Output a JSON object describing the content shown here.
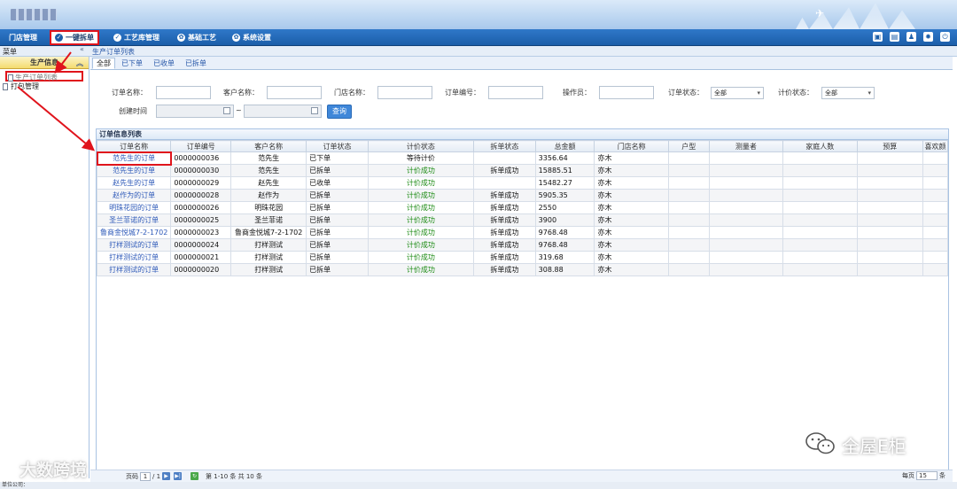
{
  "nav": {
    "items": [
      {
        "label": "门店管理",
        "icon": "none"
      },
      {
        "label": "一键拆单",
        "icon": "check-circle-icon"
      },
      {
        "label": "工艺库管理",
        "icon": "check-circle-icon"
      },
      {
        "label": "基础工艺",
        "icon": "gear-icon"
      },
      {
        "label": "系统设置",
        "icon": "gear-icon"
      }
    ],
    "tool_icons": [
      "monitor-icon",
      "document-icon",
      "users-icon",
      "gear-icon",
      "exit-icon"
    ]
  },
  "breadcrumb": {
    "menu": "菜单",
    "collapse": "«",
    "current": "生产订单列表"
  },
  "sidebar": {
    "group": "生产信息",
    "items": [
      {
        "label": "生产订单列表"
      },
      {
        "label": "打包管理"
      }
    ]
  },
  "tabs": [
    "全部",
    "已下单",
    "已收单",
    "已拆单"
  ],
  "filter": {
    "order_name_label": "订单名称：",
    "customer_name_label": "客户名称：",
    "store_name_label": "门店名称：",
    "order_no_label": "订单编号：",
    "operator_label": "操作员：",
    "order_status_label": "订单状态：",
    "order_status_value": "全部",
    "price_status_label": "计价状态：",
    "price_status_value": "全部",
    "created_label": "创建时间",
    "range_sep": "~",
    "query_button": "查询"
  },
  "table": {
    "title": "订单信息列表",
    "columns": [
      "订单名称",
      "订单编号",
      "客户名称",
      "订单状态",
      "计价状态",
      "拆单状态",
      "总金额",
      "门店名称",
      "户型",
      "测量者",
      "家庭人数",
      "预算",
      "喜欢颜"
    ],
    "rows": [
      [
        "范先生的订单",
        "0000000036",
        "范先生",
        "已下单",
        "等待计价",
        "",
        "3356.64",
        "亦木"
      ],
      [
        "范先生的订单",
        "0000000030",
        "范先生",
        "已拆单",
        "计价成功",
        "拆单成功",
        "15885.51",
        "亦木"
      ],
      [
        "赵先生的订单",
        "0000000029",
        "赵先生",
        "已收单",
        "计价成功",
        "",
        "15482.27",
        "亦木"
      ],
      [
        "赵作为的订单",
        "0000000028",
        "赵作为",
        "已拆单",
        "计价成功",
        "拆单成功",
        "5905.35",
        "亦木"
      ],
      [
        "明珠花园的订单",
        "0000000026",
        "明珠花园",
        "已拆单",
        "计价成功",
        "拆单成功",
        "2550",
        "亦木"
      ],
      [
        "圣兰菲诺的订单",
        "0000000025",
        "圣兰菲诺",
        "已拆单",
        "计价成功",
        "拆单成功",
        "3900",
        "亦木"
      ],
      [
        "鲁商金悦城7-2-1702",
        "0000000023",
        "鲁商金悦城7-2-1702",
        "已拆单",
        "计价成功",
        "拆单成功",
        "9768.48",
        "亦木"
      ],
      [
        "打样测试的订单",
        "0000000024",
        "打样测试",
        "已拆单",
        "计价成功",
        "拆单成功",
        "9768.48",
        "亦木"
      ],
      [
        "打样测试的订单",
        "0000000021",
        "打样测试",
        "已拆单",
        "计价成功",
        "拆单成功",
        "319.68",
        "亦木"
      ],
      [
        "打样测试的订单",
        "0000000020",
        "打样测试",
        "已拆单",
        "计价成功",
        "拆单成功",
        "308.88",
        "亦木"
      ]
    ]
  },
  "pager": {
    "page_label": "页码",
    "page_value": "1",
    "total_pages": "/ 1",
    "summary": "第 1-10 条  共 10 条",
    "per_page_label": "每页",
    "per_page_value": "15",
    "per_page_unit": "条"
  },
  "footer": {
    "company": "单位公司："
  },
  "watermarks": {
    "left": "大数跨境",
    "right": "全屋E柜"
  },
  "colors": {
    "nav_bg": "#1b5ea9",
    "highlight": "#e0141c",
    "link": "#2c58b8",
    "success": "#1a8a12",
    "sidebar_head": "#f4dc6e"
  }
}
